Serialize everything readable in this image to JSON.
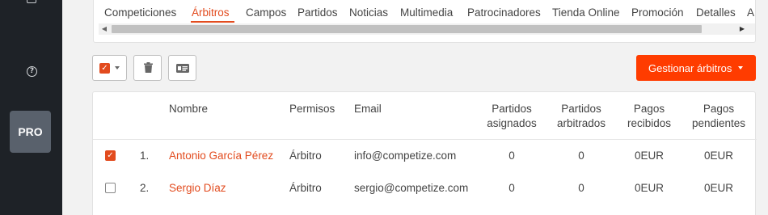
{
  "sidebar": {
    "help_icon_glyph": "?",
    "pro_label": "PRO"
  },
  "tabs": [
    {
      "label": "Competiciones"
    },
    {
      "label": "Árbitros",
      "active": true
    },
    {
      "label": "Campos"
    },
    {
      "label": "Partidos"
    },
    {
      "label": "Noticias"
    },
    {
      "label": "Multimedia"
    },
    {
      "label": "Patrocinadores"
    },
    {
      "label": "Tienda Online"
    },
    {
      "label": "Promoción"
    },
    {
      "label": "Detalles"
    },
    {
      "label": "A"
    }
  ],
  "toolbar": {
    "check_glyph": "✓",
    "manage_label": "Gestionar árbitros"
  },
  "table": {
    "headers": {
      "name": "Nombre",
      "permissions": "Permisos",
      "email": "Email",
      "assigned_1": "Partidos",
      "assigned_2": "asignados",
      "refereed_1": "Partidos",
      "refereed_2": "arbitrados",
      "received_1": "Pagos",
      "received_2": "recibidos",
      "pending_1": "Pagos",
      "pending_2": "pendientes"
    },
    "rows": [
      {
        "checked": true,
        "index": "1.",
        "name": "Antonio García Pérez",
        "permission": "Árbitro",
        "email": "info@competize.com",
        "assigned": "0",
        "refereed": "0",
        "received": "0EUR",
        "pending": "0EUR"
      },
      {
        "checked": false,
        "index": "2.",
        "name": "Sergio Díaz",
        "permission": "Árbitro",
        "email": "sergio@competize.com",
        "assigned": "0",
        "refereed": "0",
        "received": "0EUR",
        "pending": "0EUR"
      }
    ]
  },
  "colors": {
    "accent": "#e24b1e",
    "primary_button": "#ff3c00",
    "sidebar_bg": "#1e2227",
    "pro_badge": "#59616c"
  }
}
